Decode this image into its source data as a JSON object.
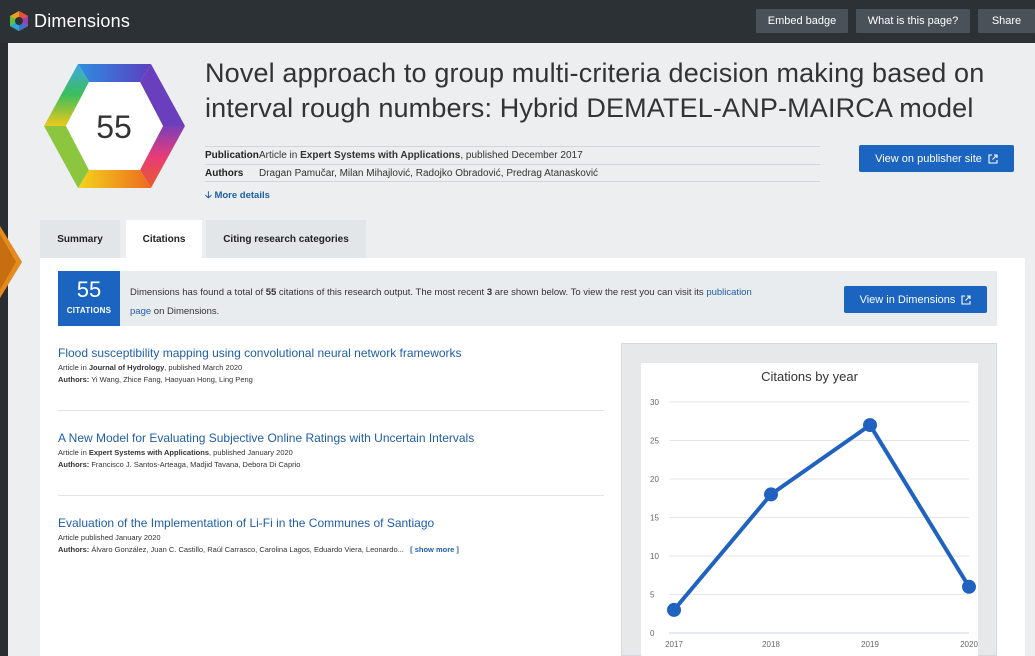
{
  "app": {
    "name": "Dimensions"
  },
  "header": {
    "buttons": [
      "Embed badge",
      "What is this page?",
      "Share"
    ]
  },
  "badge": {
    "score": "55"
  },
  "article": {
    "title_line1": "Novel approach to group multi-criteria decision making based on",
    "title_line2": "interval rough numbers: Hybrid DEMATEL-ANP-MAIRCA model",
    "publication_label": "Publication",
    "publication_prefix": "Article in ",
    "publication_journal": "Expert Systems with Applications",
    "publication_suffix": ", published December 2017",
    "authors_label": "Authors",
    "authors": "Dragan Pamučar, Milan Mihajlović, Radojko Obradović, Predrag Atanasković",
    "more_details": "More details",
    "publisher_button": "View on publisher site"
  },
  "tabs": [
    "Summary",
    "Citations",
    "Citing research categories"
  ],
  "citations": {
    "count": "55",
    "count_label": "CITATIONS",
    "info_part1": "Dimensions has found a total of ",
    "info_total": "55",
    "info_part2": " citations of this research output. The most recent ",
    "info_recent": "3",
    "info_part3": " are shown below. To view the rest you can visit its ",
    "info_link_a": "publication",
    "info_link_b": "page",
    "info_part4": " on Dimensions.",
    "view_button": "View in Dimensions",
    "authors_label": "Authors:",
    "show_more": "[ show more ]",
    "items": [
      {
        "title": "Flood susceptibility mapping using convolutional neural network frameworks",
        "prefix": "Article in ",
        "journal": "Journal of Hydrology",
        "suffix": ", published March 2020",
        "authors": "Yi Wang, Zhice Fang, Haoyuan Hong, Ling Peng"
      },
      {
        "title": "A New Model for Evaluating Subjective Online Ratings with Uncertain Intervals",
        "prefix": "Article in ",
        "journal": "Expert Systems with Applications",
        "suffix": ", published January 2020",
        "authors": "Francisco J. Santos-Arteaga, Madjid Tavana, Debora Di Caprio"
      },
      {
        "title": "Evaluation of the Implementation of Li-Fi in the Communes of Santiago",
        "prefix": "Article published January 2020",
        "journal": "",
        "suffix": "",
        "authors": "Álvaro González, Juan C. Castillo, Raúl Carrasco, Carolina Lagos, Eduardo Viera, Leonardo..."
      }
    ]
  },
  "colors": {
    "accent": "#1b64bf",
    "link": "#1f5ea8",
    "topbar": "#2c3136",
    "line": "#1f62bf"
  },
  "icons": [
    "dimensions-logo-icon",
    "arrow-down-icon",
    "external-link-icon"
  ],
  "chart_data": {
    "type": "line",
    "title": "Citations by year",
    "x": [
      "2017",
      "2018",
      "2019",
      "2020"
    ],
    "series": [
      {
        "values": [
          3,
          18,
          27,
          6
        ]
      }
    ],
    "yticks": [
      0,
      5,
      10,
      15,
      20,
      25,
      30
    ],
    "ylim": [
      0,
      30
    ],
    "grid": true
  }
}
